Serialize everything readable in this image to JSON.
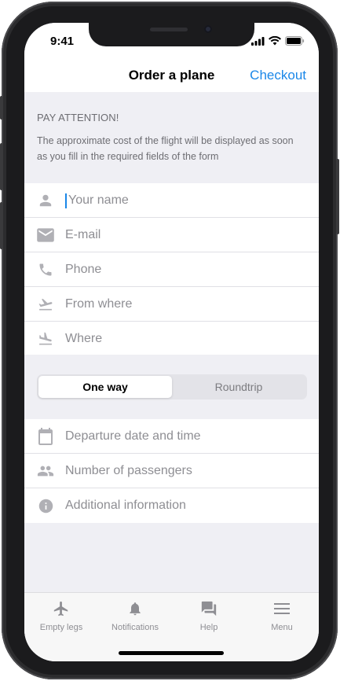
{
  "status_bar": {
    "time": "9:41"
  },
  "navbar": {
    "title": "Order a plane",
    "checkout_label": "Checkout"
  },
  "attention": {
    "heading": "PAY ATTENTION!",
    "text": "The approximate cost of the flight will be displayed as soon as you fill in the required fields of the form"
  },
  "form": {
    "fields": [
      {
        "icon": "person-icon",
        "placeholder": "Your name"
      },
      {
        "icon": "mail-icon",
        "placeholder": "E-mail"
      },
      {
        "icon": "phone-icon",
        "placeholder": "Phone"
      },
      {
        "icon": "flight-takeoff-icon",
        "placeholder": "From where"
      },
      {
        "icon": "flight-land-icon",
        "placeholder": "Where"
      }
    ]
  },
  "trip_type": {
    "options": [
      "One way",
      "Roundtrip"
    ],
    "selected": "One way"
  },
  "details": {
    "fields": [
      {
        "icon": "calendar-icon",
        "placeholder": "Departure date and time"
      },
      {
        "icon": "people-icon",
        "placeholder": "Number of passengers"
      },
      {
        "icon": "info-icon",
        "placeholder": "Additional information"
      }
    ]
  },
  "tab_bar": {
    "items": [
      {
        "icon": "airplane-icon",
        "label": "Empty legs"
      },
      {
        "icon": "bell-icon",
        "label": "Notifications"
      },
      {
        "icon": "chat-icon",
        "label": "Help"
      },
      {
        "icon": "menu-icon",
        "label": "Menu"
      }
    ]
  },
  "colors": {
    "accent": "#1a87e8",
    "icon_gray": "#b0b0b5",
    "placeholder": "#8e8e93",
    "background": "#efeff4"
  }
}
